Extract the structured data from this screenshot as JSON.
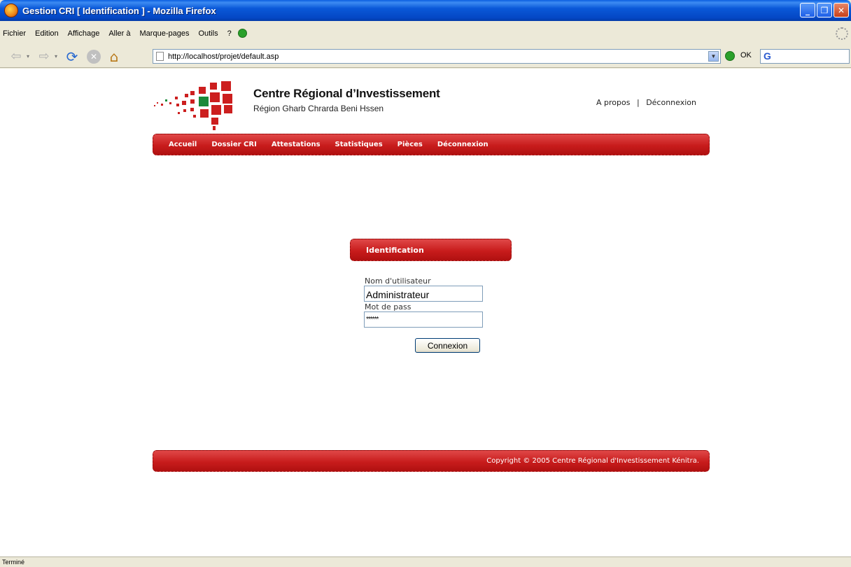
{
  "window": {
    "title": "Gestion CRI [ Identification ] - Mozilla Firefox",
    "minimize": "_",
    "maximize": "❐",
    "close": "✕"
  },
  "menu": [
    "Fichier",
    "Edition",
    "Affichage",
    "Aller à",
    "Marque-pages",
    "Outils",
    "?"
  ],
  "toolbar": {
    "url": "http://localhost/projet/default.asp",
    "go_label": "OK",
    "search_icon": "G"
  },
  "site": {
    "title": "Centre Régional d’Investissement",
    "subtitle": "Région Gharb Chrarda Beni Hssen",
    "top_links": [
      "A propos",
      "Déconnexion"
    ],
    "top_links_separator": "|",
    "nav": [
      "Accueil",
      "Dossier CRI",
      "Attestations",
      "Statistiques",
      "Pièces",
      "Déconnexion"
    ],
    "brand_red": "#c81c1c"
  },
  "login": {
    "header": "Identification",
    "username_label": "Nom d'utilisateur",
    "username_value": "Administrateur",
    "password_label": "Mot de pass",
    "password_mask": "******",
    "submit_label": "Connexion"
  },
  "footer": {
    "copyright": "Copyright © 2005 Centre Régional d'Investissement Kénitra."
  },
  "status": {
    "text": "Terminé"
  }
}
